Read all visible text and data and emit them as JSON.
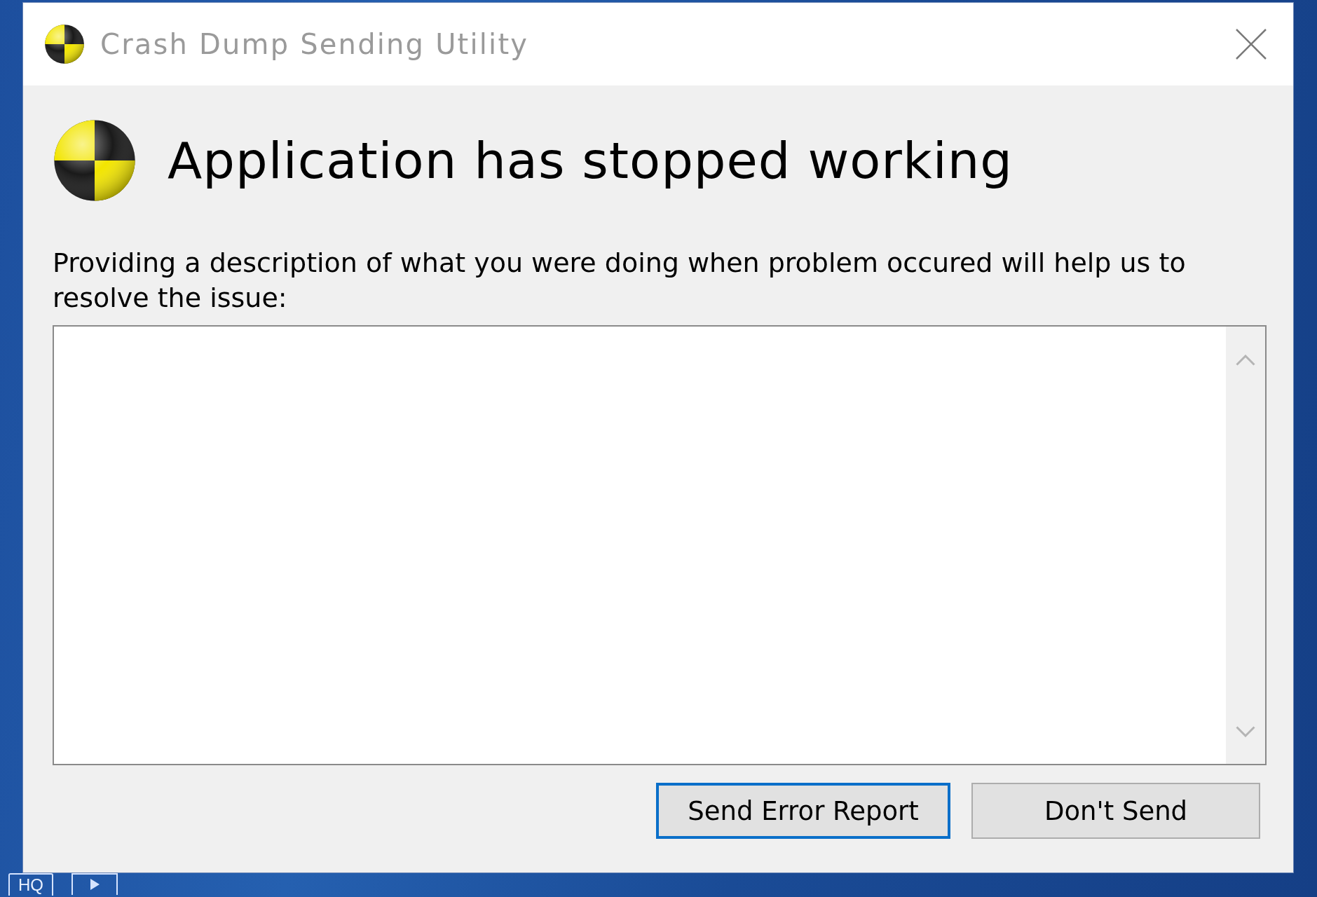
{
  "window": {
    "title": "Crash Dump Sending Utility"
  },
  "heading": "Application has stopped working",
  "description": "Providing a description of what you were doing when problem occured will help us to resolve the issue:",
  "buttons": [
    {
      "label": "Send Error Report",
      "focused": true
    },
    {
      "label": "Don't Send",
      "focused": false
    }
  ],
  "taskbar": {
    "badge": "HQ"
  }
}
